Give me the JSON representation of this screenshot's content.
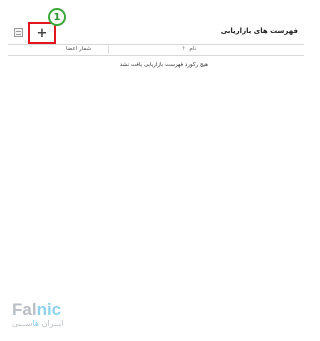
{
  "toolbar": {
    "add_label": "+",
    "step_number": "1"
  },
  "header": {
    "title": "فهرست های بازاریابی"
  },
  "table": {
    "columns": {
      "name": "نام",
      "sort_glyph": "↑",
      "members": "شمار اعضا"
    },
    "empty_message": "هیچ رکورد فهرست بازاریابی یافت نشد"
  },
  "watermark": {
    "word_start": "Fal",
    "word_accent": "nic",
    "sub_start": "ایــران ",
    "sub_accent": "ها",
    "sub_end": "ســبی"
  },
  "colors": {
    "highlight_border": "#e1161e",
    "step_badge": "#3aa93a",
    "brand_gray": "#b9bfc5",
    "brand_blue": "#8fd2f0"
  }
}
